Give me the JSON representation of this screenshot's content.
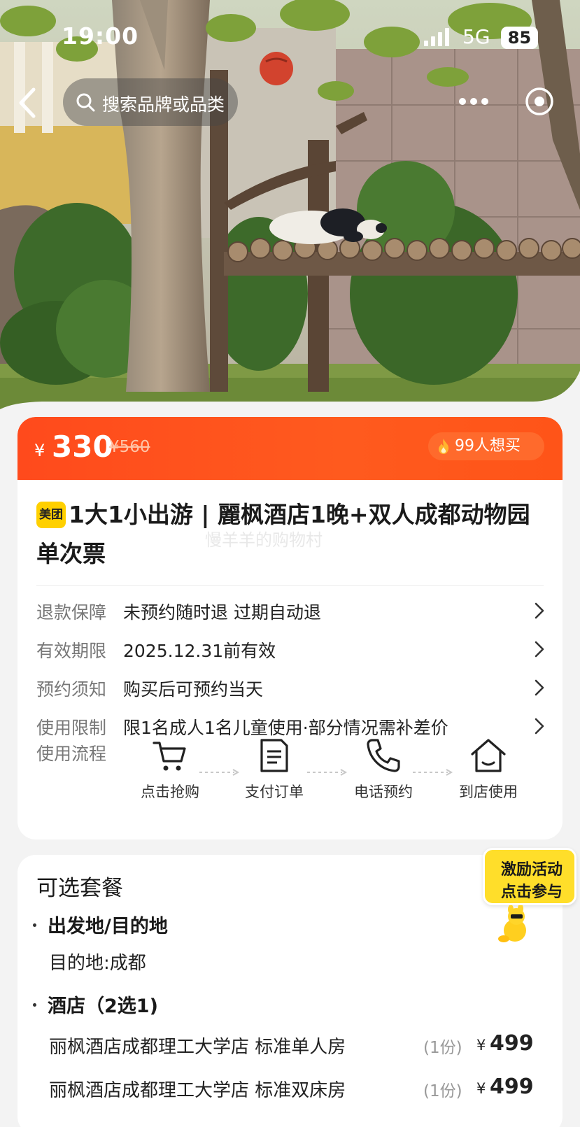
{
  "status_bar": {
    "time": "19:00",
    "network": "5G",
    "battery": "85"
  },
  "nav": {
    "search_placeholder": "搜索品牌或品类"
  },
  "price_bar": {
    "currency": "¥",
    "price": "330",
    "original_price": "¥560",
    "want_count": "99人想买"
  },
  "product": {
    "badge": "美团",
    "title": "1大1小出游 | 麗枫酒店1晚+双人成都动物园单次票",
    "watermark": "慢羊羊的购物村"
  },
  "info_rows": [
    {
      "label": "退款保障",
      "value": "未预约随时退 过期自动退"
    },
    {
      "label": "有效期限",
      "value": "2025.12.31前有效"
    },
    {
      "label": "预约须知",
      "value": "购买后可预约当天"
    },
    {
      "label": "使用限制",
      "value": "限1名成人1名儿童使用·部分情况需补差价"
    }
  ],
  "flow": {
    "label": "使用流程",
    "steps": [
      {
        "icon": "cart-icon",
        "label": "点击抢购"
      },
      {
        "icon": "document-icon",
        "label": "支付订单"
      },
      {
        "icon": "phone-icon",
        "label": "电话预约"
      },
      {
        "icon": "home-icon",
        "label": "到店使用"
      }
    ]
  },
  "packages": {
    "title": "可选套餐",
    "sections": [
      {
        "name": "出发地/目的地",
        "detail": "目的地:成都"
      },
      {
        "name": "酒店（2选1)"
      }
    ],
    "options": [
      {
        "name": "丽枫酒店成都理工大学店 标准单人房",
        "qty": "(1份)",
        "currency": "¥",
        "price": "499"
      },
      {
        "name": "丽枫酒店成都理工大学店 标准双床房",
        "qty": "(1份)",
        "currency": "¥",
        "price": "499"
      }
    ]
  },
  "promo": {
    "line1": "激励活动",
    "line2": "点击参与"
  },
  "colors": {
    "accent": "#ff4a1c",
    "brand_yellow": "#ffd000"
  }
}
